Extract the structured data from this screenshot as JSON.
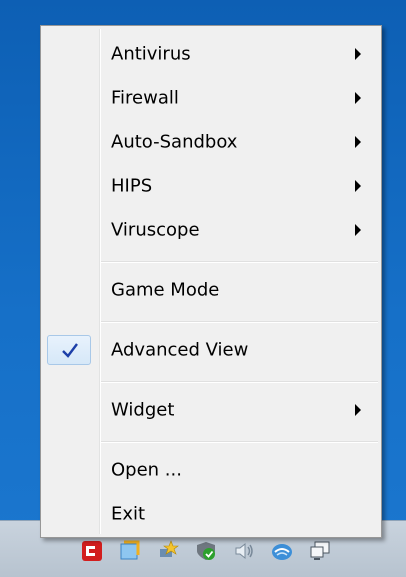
{
  "menu": {
    "items": [
      {
        "label": "Antivirus",
        "submenu": true
      },
      {
        "label": "Firewall",
        "submenu": true
      },
      {
        "label": "Auto-Sandbox",
        "submenu": true
      },
      {
        "label": "HIPS",
        "submenu": true
      },
      {
        "label": "Viruscope",
        "submenu": true
      },
      {
        "label": "Game Mode",
        "submenu": false
      },
      {
        "label": "Advanced View",
        "submenu": false,
        "checked": true
      },
      {
        "label": "Widget",
        "submenu": true
      },
      {
        "label": "Open ...",
        "submenu": false
      },
      {
        "label": "Exit",
        "submenu": false
      }
    ]
  },
  "taskbar": {
    "tray_icons": [
      "comodo-red-icon",
      "sticky-notes-icon",
      "network-star-icon",
      "shield-check-icon",
      "volume-icon",
      "comodo-cloud-icon",
      "display-icon"
    ]
  },
  "colors": {
    "desktop_blue": "#1670c8",
    "menu_bg": "#f0f0f0",
    "check_blue": "#1c3fa8"
  }
}
